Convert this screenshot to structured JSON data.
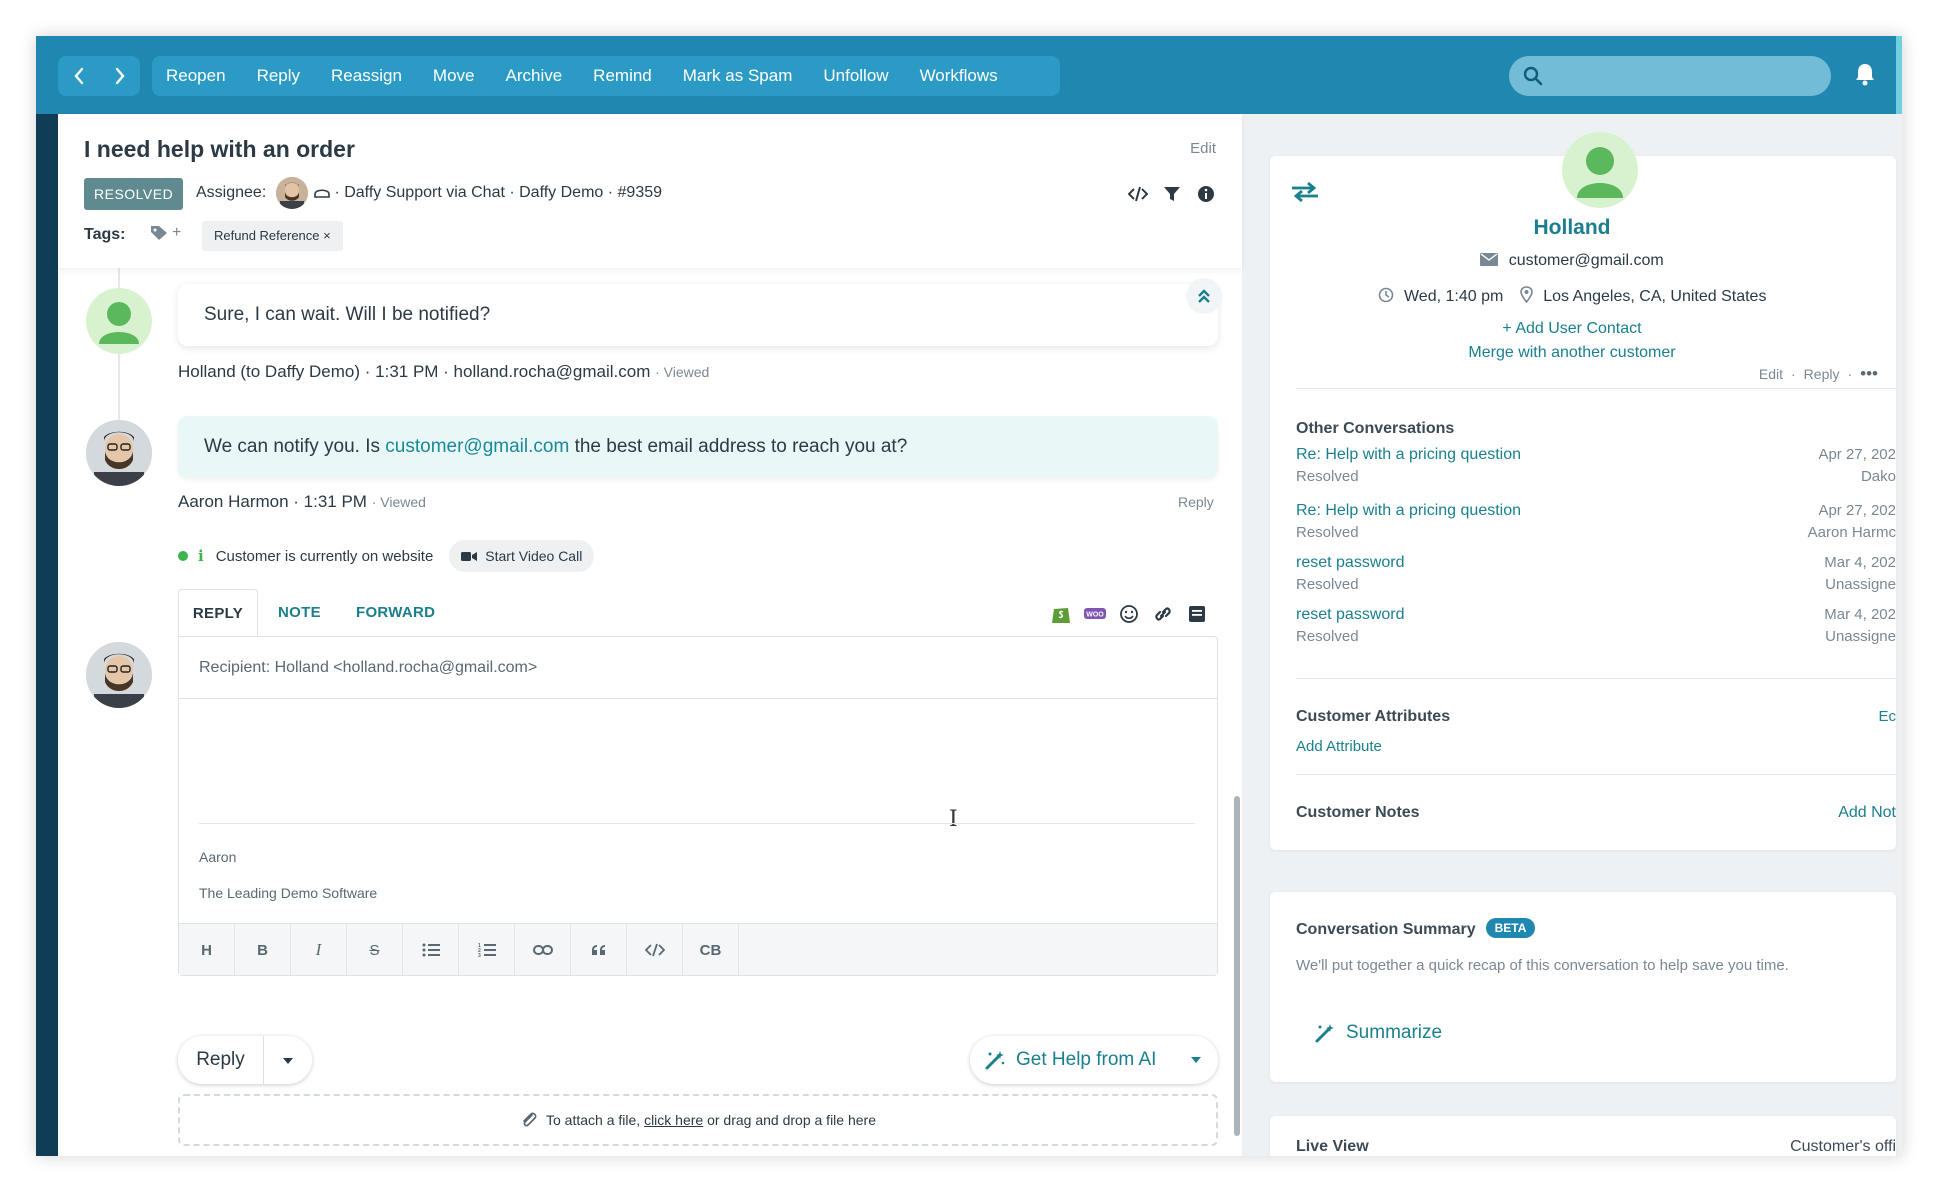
{
  "colors": {
    "topbar": "#1f87b0",
    "teal": "#1a7f8e",
    "resolved": "#5f8a8f",
    "online": "#3cb44b"
  },
  "toolbar": {
    "prev_icon": "chevron-left-icon",
    "next_icon": "chevron-right-icon",
    "actions": [
      "Reopen",
      "Reply",
      "Reassign",
      "Move",
      "Archive",
      "Remind",
      "Mark as Spam",
      "Unfollow",
      "Workflows"
    ],
    "search_placeholder": ""
  },
  "conversation": {
    "title": "I need help with an order",
    "edit_label": "Edit",
    "status": "RESOLVED",
    "assignee_label": "Assignee:",
    "channel": "· Daffy Support via Chat · Daffy Demo · #9359",
    "tags_label": "Tags:",
    "tag_add": "+",
    "tags": [
      "Refund Reference ×"
    ]
  },
  "messages": [
    {
      "text": "Sure, I can wait. Will I be notified?",
      "meta": "Holland (to Daffy Demo) · 1:31 PM · holland.rocha@gmail.com",
      "viewed": "· Viewed",
      "actions": [
        "Edit",
        "·",
        "Reply",
        "·",
        "•••"
      ]
    },
    {
      "text_before": "We can notify you. Is ",
      "text_link": "customer@gmail.com",
      "text_after": " the best email address to reach you at?",
      "meta": "Aaron Harmon · 1:31 PM",
      "viewed": "· Viewed",
      "reply": "Reply"
    }
  ],
  "presence": {
    "text": "Customer is currently on website",
    "video_button": "Start Video Call"
  },
  "composer": {
    "tabs": [
      "REPLY",
      "NOTE",
      "FORWARD"
    ],
    "recipient": "Recipient: Holland <holland.rocha@gmail.com>",
    "signature_name": "Aaron",
    "signature_company": "The Leading Demo Software",
    "format_buttons": [
      "H",
      "B",
      "I",
      "S",
      "ul",
      "ol",
      "link",
      "quote",
      "code",
      "CB"
    ],
    "reply_button": "Reply",
    "ai_button": "Get Help from AI",
    "attach_before": "To attach a file, ",
    "attach_link": "click here",
    "attach_after": " or drag and drop a file here"
  },
  "customer": {
    "name": "Holland",
    "email": "customer@gmail.com",
    "local_time": "Wed, 1:40 pm",
    "location": "Los Angeles, CA, United States",
    "add_contact": "+ Add User Contact",
    "merge": "Merge with another customer"
  },
  "other_conversations": {
    "heading": "Other Conversations",
    "items": [
      {
        "title": "Re: Help with a pricing question",
        "status": "Resolved",
        "date": "Apr 27, 202",
        "who": "Dako"
      },
      {
        "title": "Re: Help with a pricing question",
        "status": "Resolved",
        "date": "Apr 27, 202",
        "who": "Aaron Harmc"
      },
      {
        "title": "reset password",
        "status": "Resolved",
        "date": "Mar 4, 202",
        "who": "Unassigne"
      },
      {
        "title": "reset password",
        "status": "Resolved",
        "date": "Mar 4, 202",
        "who": "Unassigne"
      }
    ]
  },
  "attributes": {
    "heading": "Customer Attributes",
    "edit": "Ec",
    "add": "Add Attribute"
  },
  "notes": {
    "heading": "Customer Notes",
    "add": "Add Not"
  },
  "summary": {
    "heading": "Conversation Summary",
    "badge": "BETA",
    "text": "We'll put together a quick recap of this conversation to help save you time.",
    "button": "Summarize"
  },
  "live_view": {
    "heading": "Live View",
    "right": "Customer's offi"
  }
}
